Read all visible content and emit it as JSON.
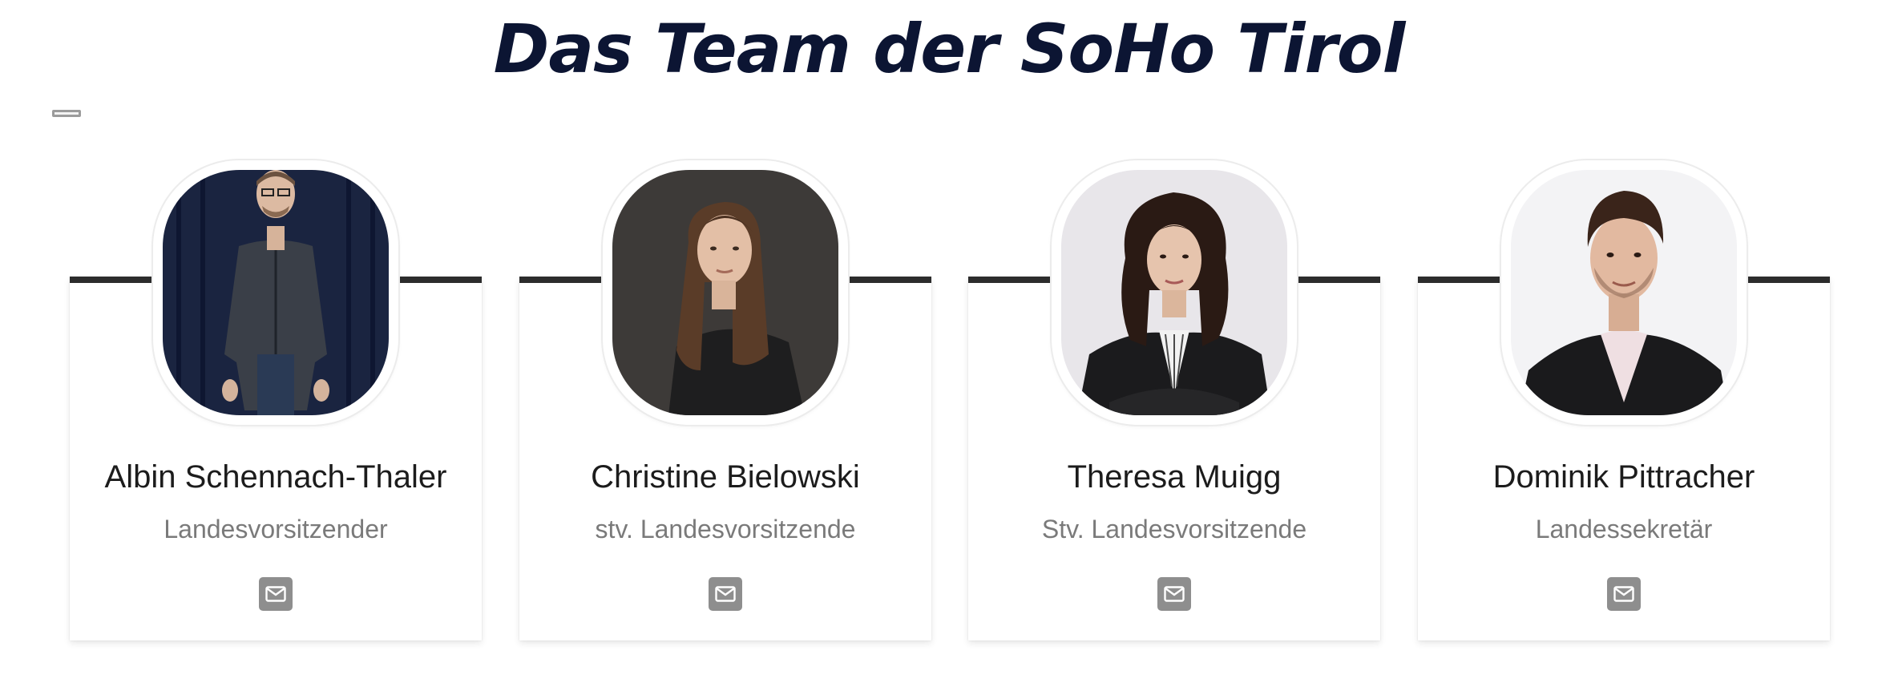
{
  "header": {
    "title": "Das Team der SoHo Tirol"
  },
  "team": [
    {
      "name": "Albin Schennach-Thaler",
      "role": "Landesvorsitzender",
      "icon": "mail-icon"
    },
    {
      "name": "Christine Bielowski",
      "role": "stv. Landesvorsitzende",
      "icon": "mail-icon"
    },
    {
      "name": "Theresa Muigg",
      "role": "Stv. Landesvorsitzende",
      "icon": "mail-icon"
    },
    {
      "name": "Dominik Pittracher",
      "role": "Landessekretär",
      "icon": "mail-icon"
    }
  ],
  "colors": {
    "title": "#0c1533",
    "accent_bar": "#2c2c2c",
    "role_text": "#7a7a7a",
    "mail_button": "#8e8e8e"
  }
}
